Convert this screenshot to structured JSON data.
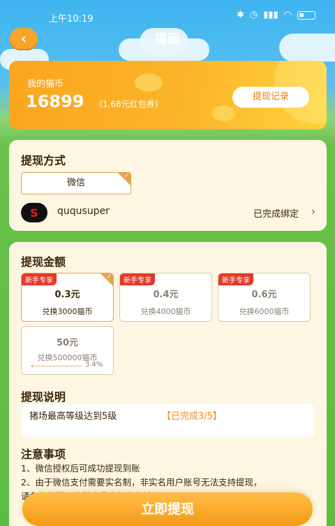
{
  "status_bar": {
    "time": "上午10:19"
  },
  "header": {
    "title": "提现",
    "back_symbol": "‹"
  },
  "coin": {
    "label": "我的猫币",
    "amount": "16899",
    "equivalent": "（1.68元红包券）",
    "record_button": "提现记录"
  },
  "method": {
    "title": "提现方式",
    "tab": "微信",
    "account_name": "ququsuper",
    "bind_status": "已完成绑定"
  },
  "amount_section": {
    "title": "提现金额",
    "options": [
      {
        "badge": "新手专享",
        "value": "0.3元",
        "desc": "兑换3000猫币",
        "selected": true
      },
      {
        "badge": "新手专享",
        "value": "0.4元",
        "desc": "兑换4000猫币",
        "selected": false
      },
      {
        "badge": "新手专享",
        "value": "0.6元",
        "desc": "兑换6000猫币",
        "selected": false
      },
      {
        "badge": "",
        "value": "50元",
        "desc": "兑换500000猫币",
        "progress": 0.034,
        "progress_text": "3.4%",
        "selected": false
      }
    ]
  },
  "explain": {
    "title": "提现说明",
    "requirement": "猪场最高等级达到5级",
    "requirement_status": "【已完成3/5】"
  },
  "attention": {
    "title": "注意事项",
    "lines": [
      "1、微信授权后可成功提现到账",
      "2、由于微信支付需要实名制，非实名用户账号无法支持提现，",
      "请务必将提现的微信号进行实名认证！"
    ]
  },
  "submit_button": "立即提现",
  "colors": {
    "accent": "#f5a623",
    "badge": "#e23a2a",
    "card_bg": "#fdf6e3"
  }
}
